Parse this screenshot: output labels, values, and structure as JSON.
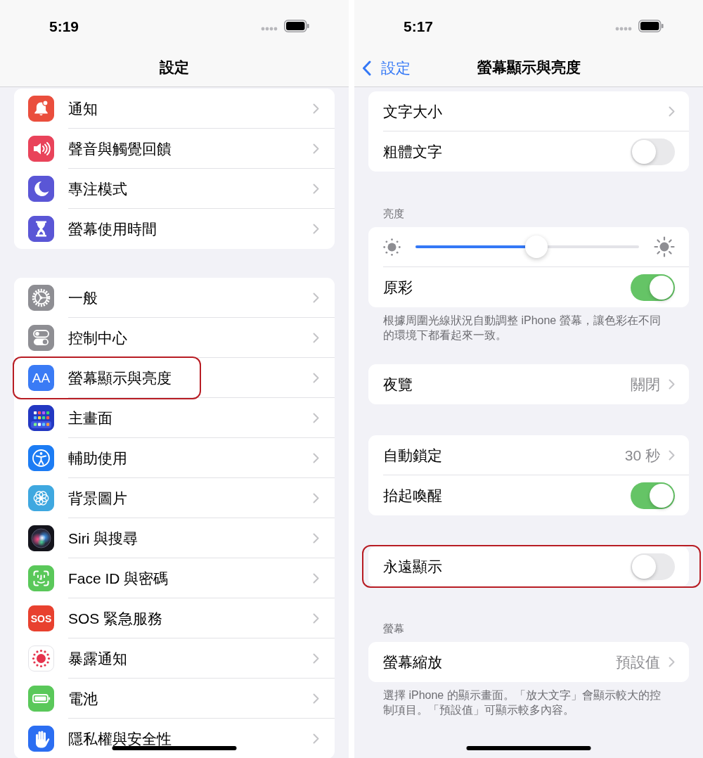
{
  "settings_screen": {
    "status_bar": {
      "time": "5:19"
    },
    "nav_bar": {
      "title": "設定"
    },
    "groups": [
      {
        "items": [
          {
            "label": "通知",
            "highlighted": false
          },
          {
            "label": "聲音與觸覺回饋",
            "highlighted": false
          },
          {
            "label": "專注模式",
            "highlighted": false
          },
          {
            "label": "螢幕使用時間",
            "highlighted": false
          }
        ]
      },
      {
        "items": [
          {
            "label": "一般",
            "highlighted": false
          },
          {
            "label": "控制中心",
            "highlighted": false
          },
          {
            "label": "螢幕顯示與亮度",
            "highlighted": true,
            "icon_text": "AA"
          },
          {
            "label": "主畫面",
            "highlighted": false
          },
          {
            "label": "輔助使用",
            "highlighted": false
          },
          {
            "label": "背景圖片",
            "highlighted": false
          },
          {
            "label": "Siri 與搜尋",
            "highlighted": false
          },
          {
            "label": "Face ID 與密碼",
            "highlighted": false
          },
          {
            "label": "SOS 緊急服務",
            "highlighted": false,
            "icon_text": "SOS"
          },
          {
            "label": "暴露通知",
            "highlighted": false
          },
          {
            "label": "電池",
            "highlighted": false
          },
          {
            "label": "隱私權與安全性",
            "highlighted": false
          }
        ]
      }
    ]
  },
  "display_screen": {
    "status_bar": {
      "time": "5:17"
    },
    "nav_bar": {
      "back": "設定",
      "title": "螢幕顯示與亮度"
    },
    "sections": [
      {
        "rows": [
          {
            "kind": "link",
            "label": "文字大小",
            "highlighted": false
          },
          {
            "kind": "toggle",
            "label": "粗體文字",
            "on": false,
            "highlighted": false
          }
        ]
      },
      {
        "header": "亮度",
        "rows": [
          {
            "kind": "slider",
            "level": 0.54,
            "highlighted": false
          },
          {
            "kind": "toggle",
            "label": "原彩",
            "on": true,
            "highlighted": false
          }
        ],
        "footer": "根據周圍光線狀況自動調整 iPhone 螢幕，讓色彩在不同的環境下都看起來一致。"
      },
      {
        "rows": [
          {
            "kind": "link",
            "label": "夜覽",
            "value": "關閉",
            "highlighted": false
          }
        ]
      },
      {
        "rows": [
          {
            "kind": "link",
            "label": "自動鎖定",
            "value": "30 秒",
            "highlighted": false
          },
          {
            "kind": "toggle",
            "label": "抬起喚醒",
            "on": true,
            "highlighted": false
          }
        ]
      },
      {
        "rows": [
          {
            "kind": "toggle",
            "label": "永遠顯示",
            "on": false,
            "highlighted": true
          }
        ]
      },
      {
        "header": "螢幕",
        "rows": [
          {
            "kind": "link",
            "label": "螢幕縮放",
            "value": "預設值",
            "highlighted": false
          }
        ],
        "footer": "選擇 iPhone 的顯示畫面。「放大文字」會顯示較大的控制項目。「預設值」可顯示較多內容。"
      }
    ]
  }
}
